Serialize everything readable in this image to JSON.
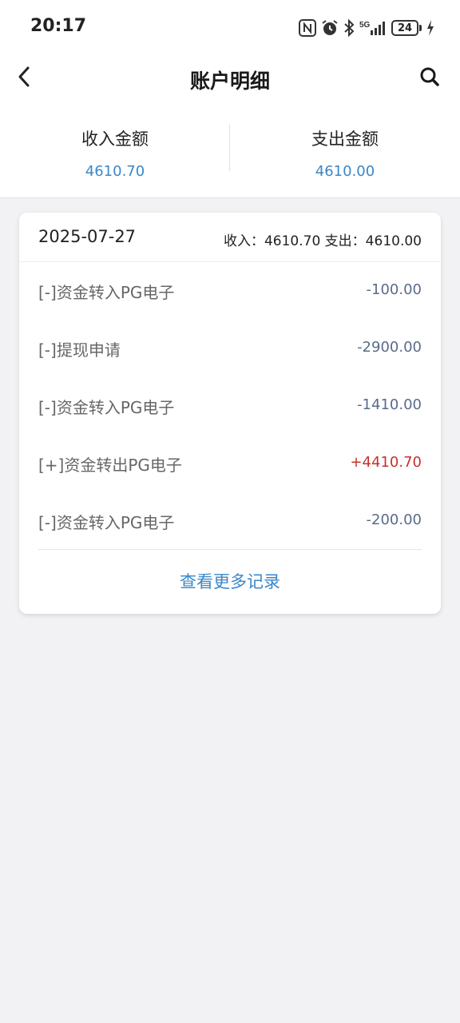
{
  "status_bar": {
    "time": "20:17",
    "network_label": "5G",
    "battery_level": "24"
  },
  "nav": {
    "title": "账户明细"
  },
  "summary": {
    "income_label": "收入金额",
    "income_value": "4610.70",
    "expense_label": "支出金额",
    "expense_value": "4610.00"
  },
  "card": {
    "date": "2025-07-27",
    "totals_text": "收入：4610.70 支出：4610.00",
    "records": [
      {
        "title": "[-]资金转入PG电子",
        "amount": "-100.00"
      },
      {
        "title": "[-]提现申请",
        "amount": "-2900.00"
      },
      {
        "title": "[-]资金转入PG电子",
        "amount": "-1410.00"
      },
      {
        "title": "[+]资金转出PG电子",
        "amount": "+4410.70"
      },
      {
        "title": "[-]资金转入PG电子",
        "amount": "-200.00"
      }
    ],
    "more_label": "查看更多记录"
  },
  "colors": {
    "accent": "#3a87c8",
    "positive_amount": "#c8302b",
    "negative_amount": "#5b6b8a"
  },
  "icons": {
    "back": "chevron-left-icon",
    "search": "search-icon"
  }
}
